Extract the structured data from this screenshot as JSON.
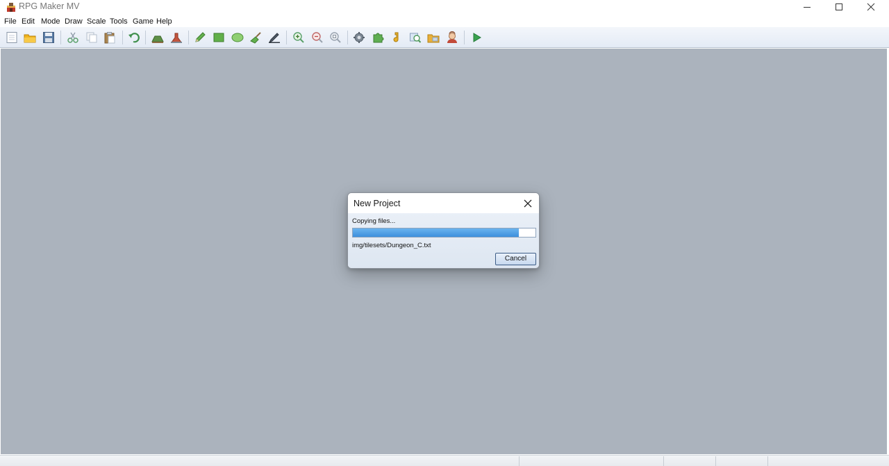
{
  "window": {
    "title": "RPG Maker MV",
    "app_icon": "rpg-maker-icon",
    "controls": [
      "minimize-icon",
      "maximize-icon",
      "close-icon"
    ]
  },
  "menu": {
    "items": [
      {
        "label": "File"
      },
      {
        "label": "Edit"
      },
      {
        "label": "Mode"
      },
      {
        "label": "Draw"
      },
      {
        "label": "Scale"
      },
      {
        "label": "Tools"
      },
      {
        "label": "Game"
      },
      {
        "label": "Help"
      }
    ]
  },
  "toolbar": {
    "buttons": [
      {
        "icon": "new-project-icon"
      },
      {
        "icon": "open-project-icon"
      },
      {
        "icon": "save-project-icon"
      },
      {
        "icon": "cut-icon"
      },
      {
        "icon": "copy-icon"
      },
      {
        "icon": "paste-icon"
      },
      {
        "icon": "undo-icon"
      },
      {
        "icon": "map-mode-icon"
      },
      {
        "icon": "event-mode-icon"
      },
      {
        "icon": "pencil-icon"
      },
      {
        "icon": "rectangle-icon"
      },
      {
        "icon": "ellipse-icon"
      },
      {
        "icon": "flood-fill-icon"
      },
      {
        "icon": "shadow-pen-icon"
      },
      {
        "icon": "zoom-in-icon"
      },
      {
        "icon": "zoom-out-icon"
      },
      {
        "icon": "zoom-actual-icon"
      },
      {
        "icon": "database-icon"
      },
      {
        "icon": "plugin-manager-icon"
      },
      {
        "icon": "sound-test-icon"
      },
      {
        "icon": "event-searcher-icon"
      },
      {
        "icon": "resource-manager-icon"
      },
      {
        "icon": "character-generator-icon"
      },
      {
        "icon": "playtest-icon"
      }
    ]
  },
  "dialog": {
    "title": "New Project",
    "status": "Copying files...",
    "current_file": "img/tilesets/Dungeon_C.txt",
    "progress": 0.91,
    "cancel_label": "Cancel"
  },
  "colors": {
    "workspace": "#abb3bd",
    "progress": "#3d8fdc"
  }
}
